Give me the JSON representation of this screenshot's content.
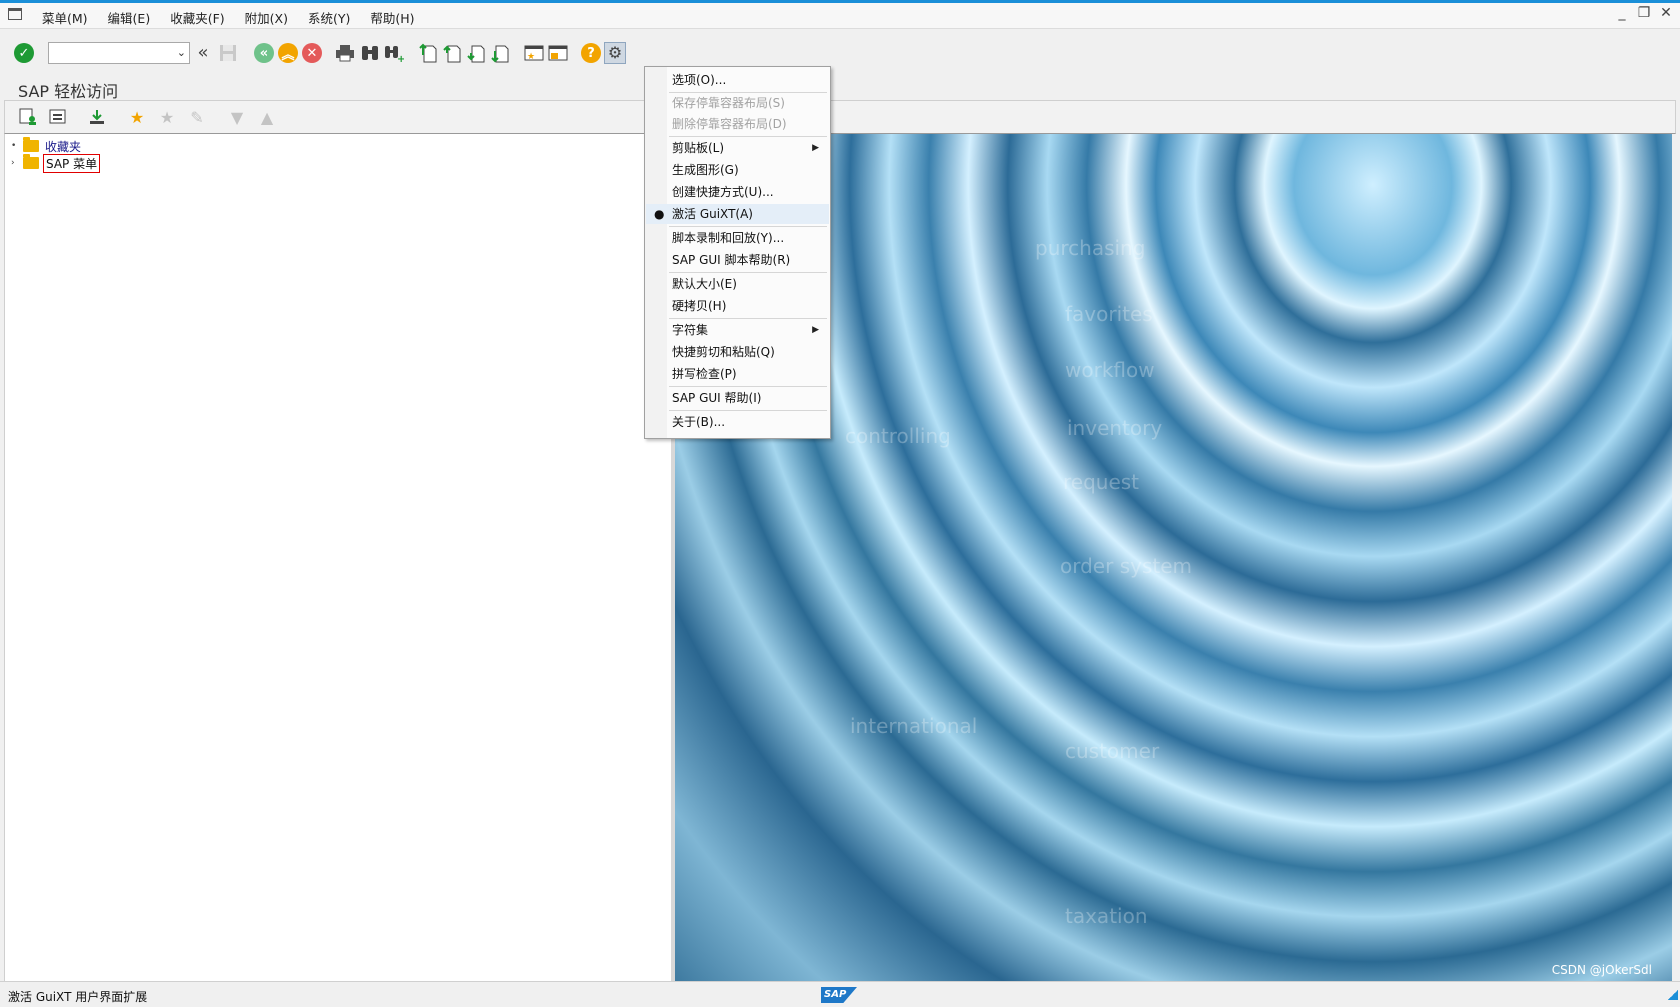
{
  "menubar": {
    "items": [
      {
        "label": "菜单(M)"
      },
      {
        "label": "编辑(E)"
      },
      {
        "label": "收藏夹(F)"
      },
      {
        "label": "附加(X)"
      },
      {
        "label": "系统(Y)"
      },
      {
        "label": "帮助(H)"
      }
    ]
  },
  "window_controls": {
    "minimize": "_",
    "restore": "❐",
    "close": "✕"
  },
  "toolbar": {
    "command_field_value": ""
  },
  "title": "SAP 轻松访问",
  "tree": {
    "items": [
      {
        "label": "收藏夹"
      },
      {
        "label": "SAP 菜单"
      }
    ]
  },
  "context_menu": {
    "items": [
      {
        "label": "选项(O)..."
      },
      {
        "label": "保存停靠容器布局(S)"
      },
      {
        "label": "删除停靠容器布局(D)"
      },
      {
        "label": "剪贴板(L)"
      },
      {
        "label": "生成图形(G)"
      },
      {
        "label": "创建快捷方式(U)..."
      },
      {
        "label": "激活 GuiXT(A)"
      },
      {
        "label": "脚本录制和回放(Y)..."
      },
      {
        "label": "SAP GUI 脚本帮助(R)"
      },
      {
        "label": "默认大小(E)"
      },
      {
        "label": "硬拷贝(H)"
      },
      {
        "label": "字符集"
      },
      {
        "label": "快捷剪切和粘贴(Q)"
      },
      {
        "label": "拼写检查(P)"
      },
      {
        "label": "SAP GUI 帮助(I)"
      },
      {
        "label": "关于(B)..."
      }
    ]
  },
  "image_panel": {
    "words": [
      "purchasing",
      "favorites",
      "workflow",
      "inventory",
      "request",
      "order system",
      "controlling",
      "international",
      "taxation",
      "customer"
    ]
  },
  "statusbar": {
    "message": "激活 GuiXT 用户界面扩展",
    "logo": "SAP",
    "credit": "CSDN @jOkerSdl"
  },
  "colors": {
    "accent": "#1a8fd8",
    "check_green": "#1e9a34",
    "nav_green": "#6fc28a",
    "nav_orange": "#f2a400",
    "nav_red": "#e45a5a",
    "help_orange": "#f2a400"
  }
}
